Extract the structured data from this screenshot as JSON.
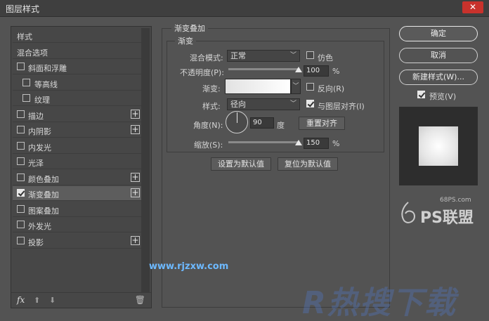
{
  "window": {
    "title": "图层样式",
    "close_glyph": "✕"
  },
  "styles_list": {
    "items": [
      {
        "label": "样式",
        "checkbox": false,
        "checked": false,
        "indent": false,
        "plus": false,
        "active": false
      },
      {
        "label": "混合选项",
        "checkbox": false,
        "checked": false,
        "indent": false,
        "plus": false,
        "active": false
      },
      {
        "label": "斜面和浮雕",
        "checkbox": true,
        "checked": false,
        "indent": false,
        "plus": false,
        "active": false
      },
      {
        "label": "等高线",
        "checkbox": true,
        "checked": false,
        "indent": true,
        "plus": false,
        "active": false
      },
      {
        "label": "纹理",
        "checkbox": true,
        "checked": false,
        "indent": true,
        "plus": false,
        "active": false
      },
      {
        "label": "描边",
        "checkbox": true,
        "checked": false,
        "indent": false,
        "plus": true,
        "active": false
      },
      {
        "label": "内阴影",
        "checkbox": true,
        "checked": false,
        "indent": false,
        "plus": true,
        "active": false
      },
      {
        "label": "内发光",
        "checkbox": true,
        "checked": false,
        "indent": false,
        "plus": false,
        "active": false
      },
      {
        "label": "光泽",
        "checkbox": true,
        "checked": false,
        "indent": false,
        "plus": false,
        "active": false
      },
      {
        "label": "颜色叠加",
        "checkbox": true,
        "checked": false,
        "indent": false,
        "plus": true,
        "active": false
      },
      {
        "label": "渐变叠加",
        "checkbox": true,
        "checked": true,
        "indent": false,
        "plus": true,
        "active": true
      },
      {
        "label": "图案叠加",
        "checkbox": true,
        "checked": false,
        "indent": false,
        "plus": false,
        "active": false
      },
      {
        "label": "外发光",
        "checkbox": true,
        "checked": false,
        "indent": false,
        "plus": false,
        "active": false
      },
      {
        "label": "投影",
        "checkbox": true,
        "checked": false,
        "indent": false,
        "plus": true,
        "active": false
      }
    ],
    "footer": {
      "fx_label": "fx",
      "up_glyph": "⬆",
      "down_glyph": "⬇",
      "trash_glyph": "🗑"
    }
  },
  "gradient_overlay": {
    "group_title": "渐变叠加",
    "sub_title": "渐变",
    "blend_mode_label": "混合模式:",
    "blend_mode_value": "正常",
    "dither_label": "仿色",
    "dither_checked": false,
    "opacity_label": "不透明度(P):",
    "opacity_value": "100",
    "opacity_unit": "%",
    "opacity_level": 1.0,
    "gradient_label": "渐变:",
    "reverse_label": "反向(R)",
    "reverse_checked": false,
    "style_label": "样式:",
    "style_value": "径向",
    "align_label": "与图层对齐(I)",
    "align_checked": true,
    "angle_label": "角度(N):",
    "angle_value": "90",
    "angle_unit": "度",
    "reset_align_label": "重置对齐",
    "scale_label": "缩放(S):",
    "scale_value": "150",
    "scale_unit": "%",
    "scale_level": 1.0,
    "set_default_label": "设置为默认值",
    "reset_default_label": "复位为默认值"
  },
  "actions": {
    "ok_label": "确定",
    "cancel_label": "取消",
    "new_style_label": "新建样式(W)...",
    "preview_label": "预览(V)",
    "preview_checked": true
  },
  "watermarks": {
    "url": "www.rjzxw.com",
    "site": "68PS.com",
    "logo_text": "PS联盟",
    "big_text": "R热搜下载"
  },
  "icons": {
    "chevron": "chevron-down-icon",
    "close": "close-icon",
    "plus": "plus-icon",
    "trash": "trash-icon"
  }
}
